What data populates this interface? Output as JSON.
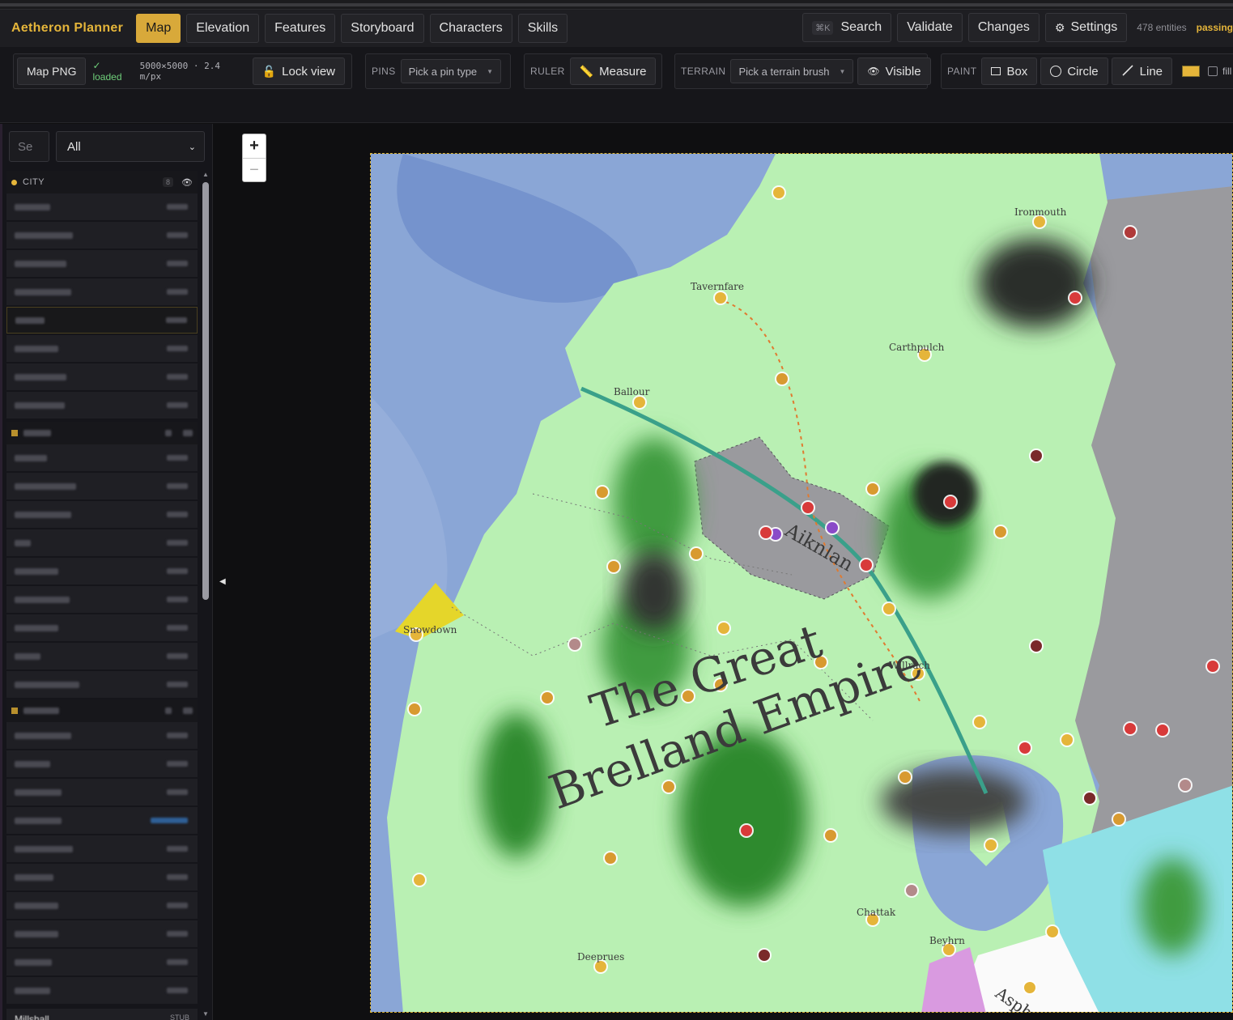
{
  "app": {
    "title": "Aetheron Planner",
    "tabs": [
      {
        "label": "Map",
        "active": true
      },
      {
        "label": "Elevation",
        "active": false
      },
      {
        "label": "Features",
        "active": false
      },
      {
        "label": "Storyboard",
        "active": false
      },
      {
        "label": "Characters",
        "active": false
      },
      {
        "label": "Skills",
        "active": false
      }
    ],
    "search_label": "Search",
    "search_shortcut": "⌘K",
    "validate_label": "Validate",
    "changes_label": "Changes",
    "settings_label": "Settings",
    "entities": "478 entities",
    "status": "passing"
  },
  "toolbar": {
    "map_png_label": "Map PNG",
    "loaded_text": "✓ loaded",
    "map_info": "5000×5000 · 2.4 m/px",
    "lock_view_label": "Lock view",
    "pins_label": "PINS",
    "pin_type_placeholder": "Pick a pin type",
    "ruler_label": "RULER",
    "measure_label": "Measure",
    "terrain_label": "TERRAIN",
    "terrain_placeholder": "Pick a terrain brush",
    "visible_label": "Visible",
    "paint_label": "PAINT",
    "box_label": "Box",
    "circle_label": "Circle",
    "line_label": "Line",
    "paint_color": "#e5b53a",
    "fill_label": "fill"
  },
  "sidebar": {
    "search_placeholder": "Se",
    "filter_value": "All",
    "group_city": {
      "name": "CITY",
      "count": "8"
    },
    "last_item": {
      "name": "Millshall",
      "tag": "STUB"
    }
  },
  "map": {
    "zoom_in": "+",
    "zoom_out": "−",
    "title_line1": "The Great",
    "title_line2": "Brelland Empire",
    "region_label": "Aiknlan",
    "place_labels": [
      "Ironmouth",
      "Tavernfare",
      "Carthpulch",
      "Ballour",
      "Snowdown",
      "Willrach",
      "Deeprues",
      "Asphen",
      "Chattak",
      "Beyhrn"
    ]
  }
}
